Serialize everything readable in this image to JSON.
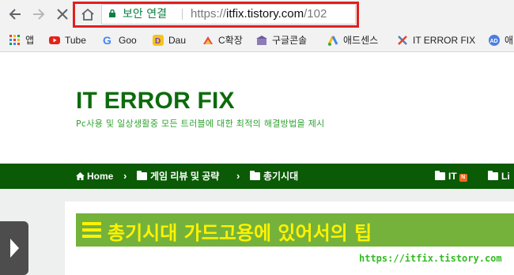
{
  "toolbar": {
    "back_icon": "back-arrow-icon",
    "forward_icon": "forward-arrow-icon",
    "stop_icon": "close-icon",
    "home_icon": "home-icon",
    "security_label": "보안 연결",
    "url_scheme": "https://",
    "url_host": "itfix.tistory.com",
    "url_path": "/102",
    "highlight_color": "#e02020"
  },
  "bookmarks": [
    {
      "label": "앱",
      "icon": "apps-grid-icon"
    },
    {
      "label": "Tube",
      "icon": "youtube-icon"
    },
    {
      "label": "Goo",
      "icon": "google-icon"
    },
    {
      "label": "Dau",
      "icon": "daum-icon"
    },
    {
      "label": "C확장",
      "icon": "extension-icon"
    },
    {
      "label": "구글콘솔",
      "icon": "console-icon"
    },
    {
      "label": "애드센스",
      "icon": "adsense-icon"
    },
    {
      "label": "IT ERROR FIX",
      "icon": "tools-icon"
    },
    {
      "label": "애",
      "icon": "ad-icon"
    }
  ],
  "site": {
    "title": "IT ERROR FIX",
    "subtitle": "Pc사용 및 일상생활중 모든 트러블에 대한 최적의 해결방법을 제시",
    "title_color": "#0d6b0d"
  },
  "nav": {
    "home": "Home",
    "crumb1": "게임 리뷰 및 공략",
    "crumb2": "총기시대",
    "right1": "IT",
    "new_badge": "N",
    "right2": "Li",
    "bar_color": "#0a5a06"
  },
  "post": {
    "title": "총기시대 가드고용에 있어서의 팁",
    "watermark": "https://itfix.tistory.com",
    "title_bg": "#74b23b",
    "title_color": "#fff200"
  }
}
